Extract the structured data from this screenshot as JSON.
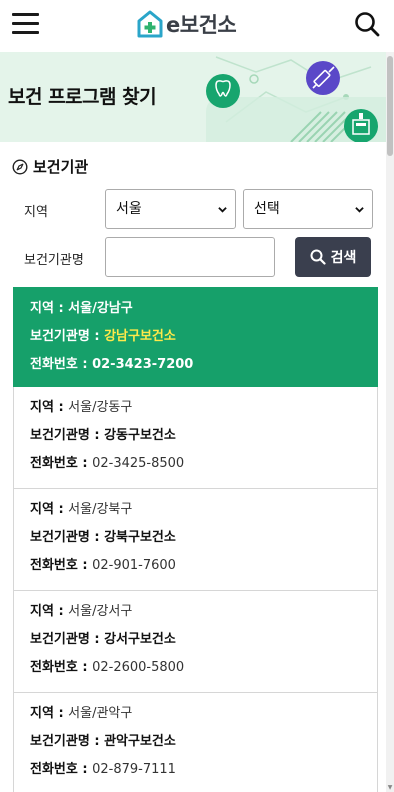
{
  "header": {
    "logo_text": "e보건소"
  },
  "banner": {
    "title": "보건 프로그램 찾기"
  },
  "search": {
    "section_title": "보건기관",
    "region_label": "지역",
    "region_value": "서울",
    "district_value": "선택",
    "name_label": "보건기관명",
    "name_value": "",
    "button_label": "검색"
  },
  "list_labels": {
    "region": "지역 : ",
    "name": "보건기관명 : ",
    "phone": "전화번호 : "
  },
  "results": [
    {
      "region": "서울/강남구",
      "name": "강남구보건소",
      "phone": "02-3423-7200",
      "selected": true
    },
    {
      "region": "서울/강동구",
      "name": "강동구보건소",
      "phone": "02-3425-8500",
      "selected": false
    },
    {
      "region": "서울/강북구",
      "name": "강북구보건소",
      "phone": "02-901-7600",
      "selected": false
    },
    {
      "region": "서울/강서구",
      "name": "강서구보건소",
      "phone": "02-2600-5800",
      "selected": false
    },
    {
      "region": "서울/관악구",
      "name": "관악구보건소",
      "phone": "02-879-7111",
      "selected": false
    }
  ],
  "colors": {
    "accent": "#16a06a",
    "highlight_name": "#ffe94a",
    "banner_bg": "#e4f4ea",
    "button_bg": "#3a3f4e"
  },
  "icons": [
    "menu-icon",
    "logo-icon",
    "search-icon",
    "tooth-icon",
    "syringe-icon",
    "hospital-icon",
    "compass-icon",
    "chevron-down-icon"
  ]
}
